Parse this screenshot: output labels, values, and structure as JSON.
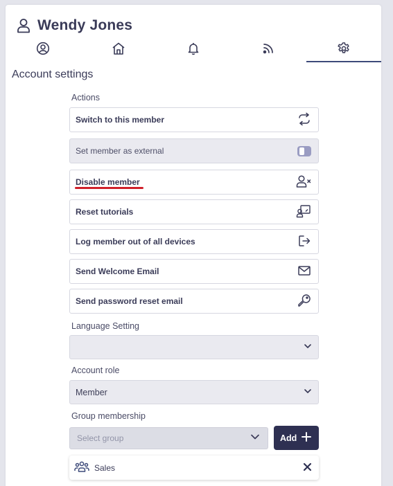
{
  "header": {
    "title": "Wendy Jones",
    "icon": "user-icon"
  },
  "tabs": [
    {
      "icon": "profile-icon",
      "active": false
    },
    {
      "icon": "home-icon",
      "active": false
    },
    {
      "icon": "bell-icon",
      "active": false
    },
    {
      "icon": "rss-icon",
      "active": false
    },
    {
      "icon": "gear-icon",
      "active": true
    }
  ],
  "section_title": "Account settings",
  "actions_label": "Actions",
  "actions": [
    {
      "label": "Switch to this member",
      "icon": "switch-arrows-icon"
    },
    {
      "label": "Set member as external",
      "icon": "toggle-icon",
      "disabled": true
    },
    {
      "label": "Disable member",
      "icon": "user-remove-icon",
      "highlight_color": "#d0202a"
    },
    {
      "label": "Reset tutorials",
      "icon": "tutorial-icon"
    },
    {
      "label": "Log member out of all devices",
      "icon": "logout-icon"
    },
    {
      "label": "Send Welcome Email",
      "icon": "mail-icon"
    },
    {
      "label": "Send password reset email",
      "icon": "key-icon"
    }
  ],
  "language": {
    "label": "Language Setting",
    "value": ""
  },
  "account_role": {
    "label": "Account role",
    "value": "Member"
  },
  "group_membership": {
    "label": "Group membership",
    "placeholder": "Select group",
    "add_label": "Add",
    "groups": [
      {
        "name": "Sales",
        "icon": "group-icon"
      }
    ]
  },
  "colors": {
    "accent": "#2e3052",
    "tab_underline": "#3d4a7a",
    "highlight": "#d0202a"
  }
}
